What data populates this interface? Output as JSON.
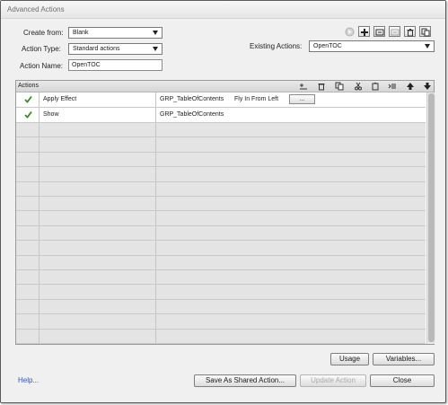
{
  "window": {
    "title": "Advanced Actions"
  },
  "form": {
    "create_from_label": "Create from:",
    "create_from_value": "Blank",
    "action_type_label": "Action Type:",
    "action_type_value": "Standard actions",
    "action_name_label": "Action Name:",
    "action_name_value": "OpenTOC",
    "existing_actions_label": "Existing Actions:",
    "existing_actions_value": "OpenTOC"
  },
  "actions_panel": {
    "title": "Actions",
    "rows": [
      {
        "status": "check",
        "action": "Apply Effect",
        "target": "GRP_TableOfContents",
        "detail": "Fly In From Left",
        "button": "..."
      },
      {
        "status": "check",
        "action": "Show",
        "target": "GRP_TableOfContents"
      }
    ],
    "empty_rows": 15
  },
  "buttons": {
    "usage": "Usage",
    "variables": "Variables...",
    "save_shared": "Save As Shared Action...",
    "update_action": "Update Action",
    "close": "Close"
  },
  "help_link": "Help...",
  "colors": {
    "check": "#3a8a1e",
    "link": "#2a56b8"
  }
}
